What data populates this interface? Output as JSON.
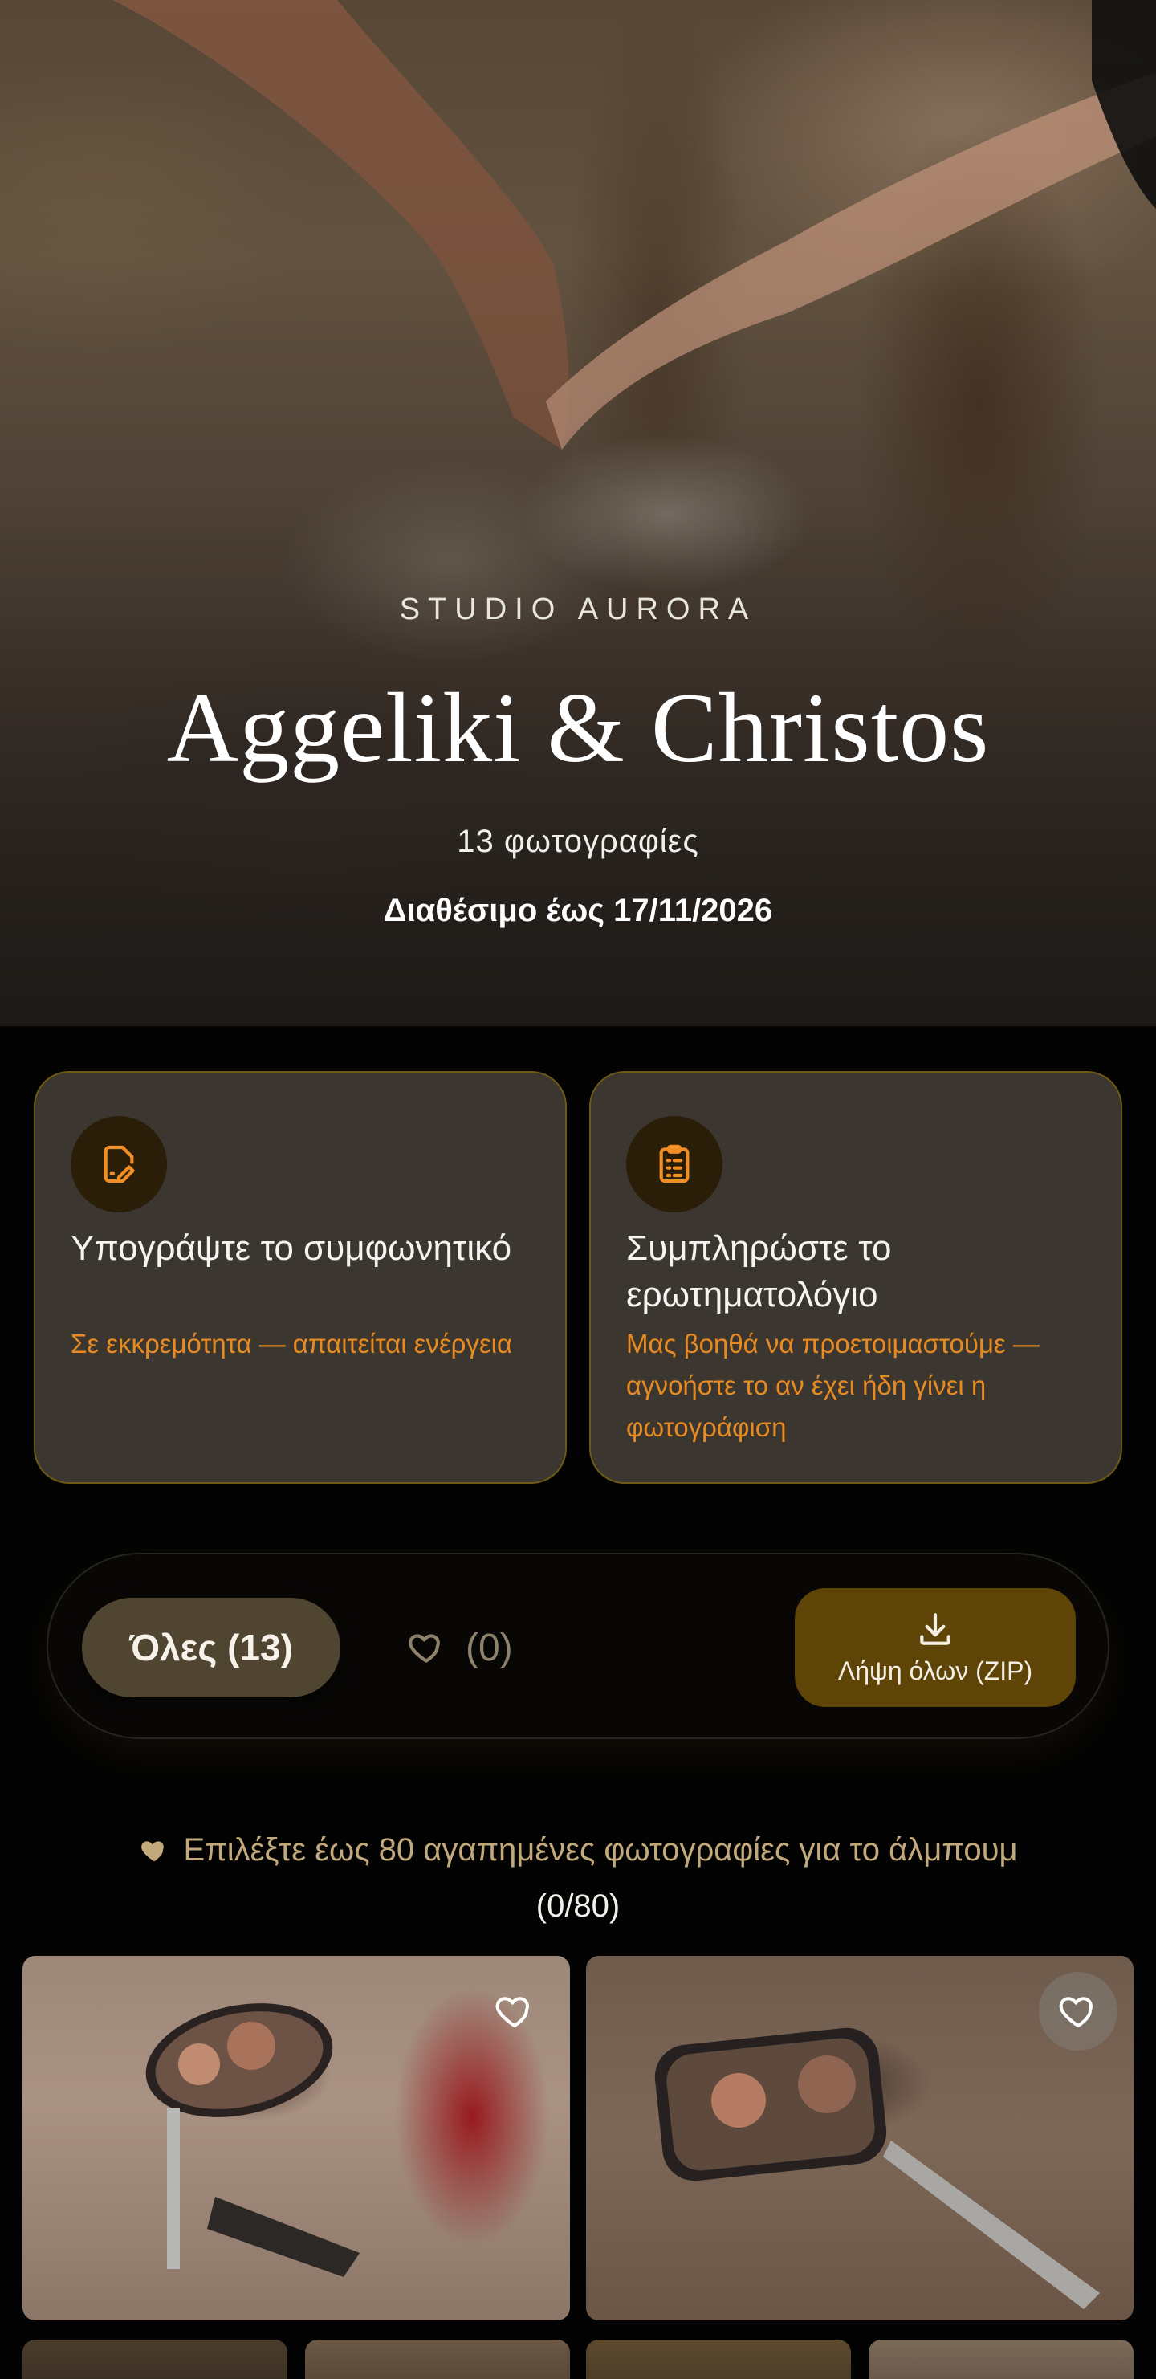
{
  "hero": {
    "studio": "STUDIO AURORA",
    "couple": "Aggeliki & Christos",
    "photo_count": "13 φωτογραφίες",
    "availability": "Διαθέσιμο έως 17/11/2026"
  },
  "cards": [
    {
      "icon": "edit-document-icon",
      "title": "Υπογράψτε το συμφωνητικό",
      "subtitle": "Σε εκκρεμότητα — απαιτείται ενέργεια"
    },
    {
      "icon": "clipboard-list-icon",
      "title": "Συμπληρώστε το ερωτηματολόγιο",
      "subtitle": "Μας βοηθά να προετοιμαστούμε — αγνοήστε το αν έχει ήδη γίνει η φωτογράφιση"
    }
  ],
  "filters": {
    "all_label": "Όλες (13)",
    "favorites_count": "(0)",
    "download_label": "Λήψη όλων (ZIP)"
  },
  "favorites_hint": {
    "line1": "Επιλέξτε έως 80 αγαπημένες φωτογραφίες για το άλμπουμ",
    "line2": "(0/80)"
  },
  "colors": {
    "accent_orange": "#e88a22",
    "card_border": "#6e5a14",
    "download_button": "#5f4408"
  }
}
